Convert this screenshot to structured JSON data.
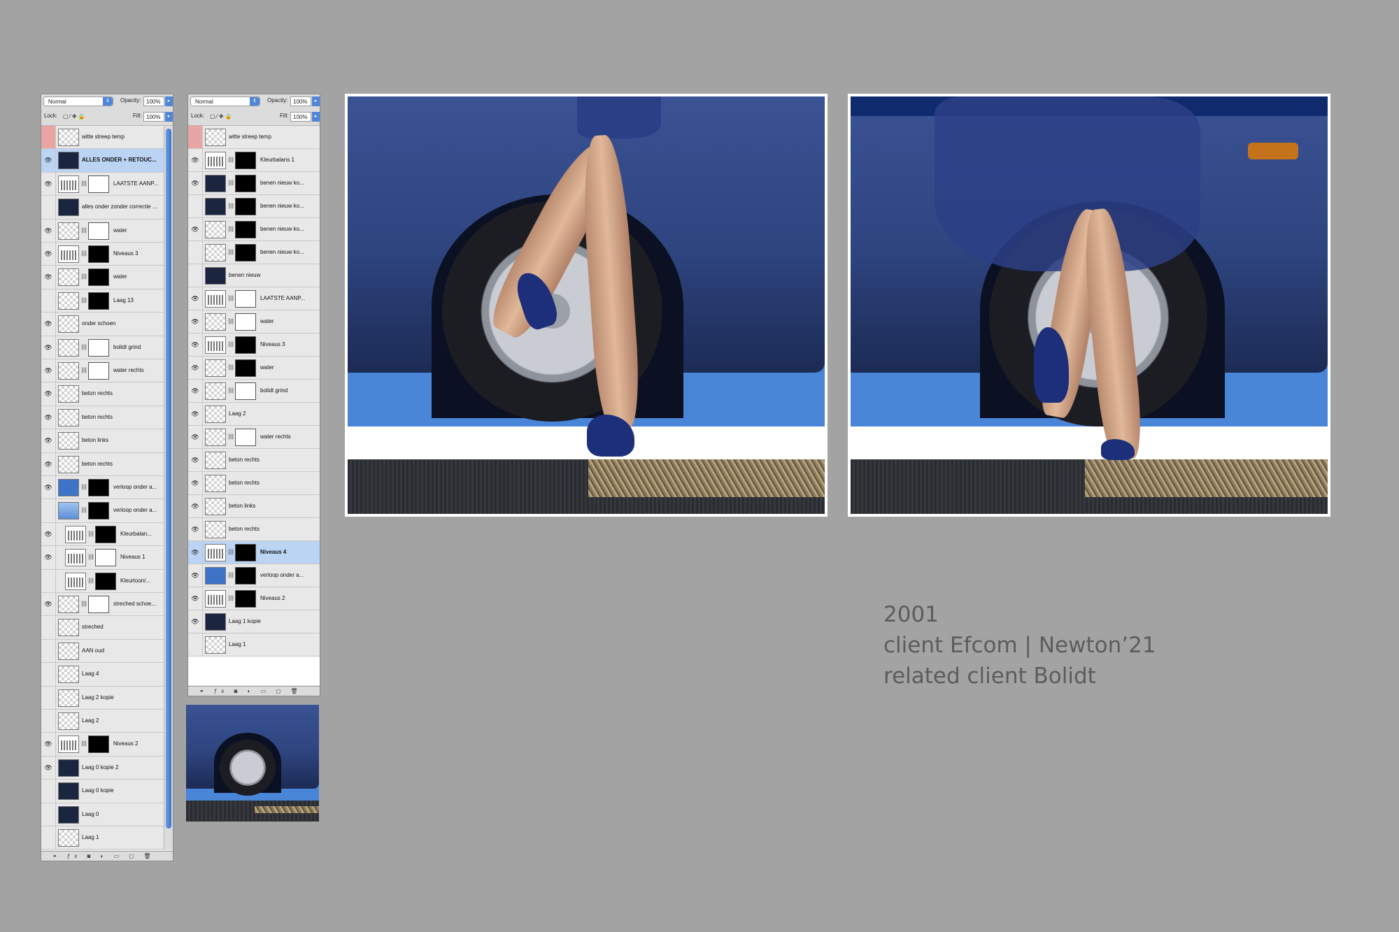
{
  "panel_left": {
    "blend_mode": "Normal",
    "opacity_label": "Opacity:",
    "opacity_value": "100%",
    "lock_label": "Lock:",
    "fill_label": "Fill:",
    "fill_value": "100%",
    "layers": [
      {
        "name": "witte streep temp",
        "visible": false,
        "eye_pink": true,
        "thumb": "checker",
        "mask": null
      },
      {
        "name": "ALLES ONDER + RETOUC...",
        "visible": true,
        "selected": true,
        "thumb": "dark",
        "mask": null
      },
      {
        "name": "LAATSTE AANP...",
        "visible": true,
        "thumb": "adj",
        "mask": "white"
      },
      {
        "name": "alles onder zonder correctie ...",
        "visible": false,
        "thumb": "dark",
        "mask": null
      },
      {
        "name": "water",
        "visible": true,
        "thumb": "checker",
        "mask": "white"
      },
      {
        "name": "Niveaus 3",
        "visible": true,
        "thumb": "adj",
        "mask": "black"
      },
      {
        "name": "water",
        "visible": true,
        "thumb": "checker",
        "mask": "black"
      },
      {
        "name": "Laag 13",
        "visible": false,
        "thumb": "checker",
        "mask": "black"
      },
      {
        "name": "onder schoen",
        "visible": true,
        "thumb": "checker",
        "mask": null
      },
      {
        "name": "bolidt grind",
        "visible": true,
        "thumb": "checker",
        "mask": "white"
      },
      {
        "name": "water rechts",
        "visible": true,
        "thumb": "checker",
        "mask": "white"
      },
      {
        "name": "beton rechts",
        "visible": true,
        "thumb": "checker",
        "mask": null
      },
      {
        "name": "beton rechts",
        "visible": true,
        "thumb": "checker",
        "mask": null
      },
      {
        "name": "beton links",
        "visible": true,
        "thumb": "checker",
        "mask": null
      },
      {
        "name": "beton rechts",
        "visible": true,
        "thumb": "checker",
        "mask": null
      },
      {
        "name": "verloop onder a...",
        "visible": true,
        "thumb": "blue",
        "mask": "black"
      },
      {
        "name": "verloop onder a...",
        "visible": false,
        "thumb": "lblue",
        "mask": "black"
      },
      {
        "name": "Kleurbalan...",
        "visible": true,
        "indent": true,
        "thumb": "adj",
        "mask": "black"
      },
      {
        "name": "Niveaus 1",
        "visible": true,
        "indent": true,
        "thumb": "adj",
        "mask": "white"
      },
      {
        "name": "Kleurtoon/...",
        "visible": false,
        "indent": true,
        "thumb": "adj",
        "mask": "black"
      },
      {
        "name": "streched schoe...",
        "visible": true,
        "thumb": "checker",
        "mask": "white"
      },
      {
        "name": "streched",
        "visible": false,
        "thumb": "checker",
        "mask": null
      },
      {
        "name": "AAN oud",
        "visible": false,
        "thumb": "checker",
        "mask": null
      },
      {
        "name": "Laag 4",
        "visible": false,
        "thumb": "checker",
        "mask": null
      },
      {
        "name": "Laag 2 kopie",
        "visible": false,
        "thumb": "checker",
        "mask": null
      },
      {
        "name": "Laag 2",
        "visible": false,
        "thumb": "checker",
        "mask": null
      },
      {
        "name": "Niveaus 2",
        "visible": true,
        "thumb": "adj",
        "mask": "black"
      },
      {
        "name": "Laag 0 kopie 2",
        "visible": true,
        "thumb": "dark",
        "mask": null
      },
      {
        "name": "Laag 0 kopie",
        "visible": false,
        "thumb": "dark",
        "mask": null
      },
      {
        "name": "Laag 0",
        "visible": false,
        "thumb": "dark",
        "mask": null
      },
      {
        "name": "Laag 1",
        "visible": false,
        "thumb": "checker",
        "mask": null
      }
    ],
    "footer_icons": "⚭ ƒx ◙ ◐ ▭ ◻ 🗑"
  },
  "panel_right": {
    "blend_mode": "Normal",
    "opacity_label": "Opacity:",
    "opacity_value": "100%",
    "lock_label": "Lock:",
    "fill_label": "Fill:",
    "fill_value": "100%",
    "layers": [
      {
        "name": "witte streep temp",
        "visible": false,
        "eye_pink": true,
        "thumb": "checker",
        "mask": null
      },
      {
        "name": "Kleurbalans 1",
        "visible": true,
        "thumb": "adj",
        "mask": "black"
      },
      {
        "name": "benen nieuw ko...",
        "visible": true,
        "thumb": "dark",
        "mask": "black"
      },
      {
        "name": "benen nieuw ko...",
        "visible": false,
        "thumb": "dark",
        "mask": "black"
      },
      {
        "name": "benen nieuw ko...",
        "visible": true,
        "thumb": "checker",
        "mask": "black"
      },
      {
        "name": "benen nieuw ko...",
        "visible": false,
        "thumb": "checker",
        "mask": "black"
      },
      {
        "name": "benen nieuw",
        "visible": false,
        "thumb": "dark",
        "mask": null
      },
      {
        "name": "LAATSTE AANP...",
        "visible": true,
        "thumb": "adj",
        "mask": "white"
      },
      {
        "name": "water",
        "visible": true,
        "thumb": "checker",
        "mask": "white"
      },
      {
        "name": "Niveaus 3",
        "visible": true,
        "thumb": "adj",
        "mask": "black"
      },
      {
        "name": "water",
        "visible": true,
        "thumb": "checker",
        "mask": "black"
      },
      {
        "name": "bolidt grind",
        "visible": true,
        "thumb": "checker",
        "mask": "white"
      },
      {
        "name": "Laag 2",
        "visible": true,
        "thumb": "checker",
        "mask": null
      },
      {
        "name": "water rechts",
        "visible": true,
        "thumb": "checker",
        "mask": "white"
      },
      {
        "name": "beton rechts",
        "visible": true,
        "thumb": "checker",
        "mask": null
      },
      {
        "name": "beton rechts",
        "visible": true,
        "thumb": "checker",
        "mask": null
      },
      {
        "name": "beton links",
        "visible": true,
        "thumb": "checker",
        "mask": null
      },
      {
        "name": "beton rechts",
        "visible": true,
        "thumb": "checker",
        "mask": null
      },
      {
        "name": "Niveaus 4",
        "visible": true,
        "selected": true,
        "thumb": "adj",
        "mask": "black"
      },
      {
        "name": "verloop onder a...",
        "visible": true,
        "thumb": "blue",
        "mask": "black"
      },
      {
        "name": "Niveaus 2",
        "visible": true,
        "thumb": "adj",
        "mask": "black"
      },
      {
        "name": "Laag 1 kopie",
        "visible": true,
        "thumb": "dark",
        "mask": null
      },
      {
        "name": "Laag 1",
        "visible": false,
        "thumb": "checker",
        "mask": null
      }
    ],
    "footer_icons": "⚭ ƒx ◙ ◐ ▭ ◻ 🗑"
  },
  "caption": {
    "year": "2001",
    "client": "client Efcom | Newton’21",
    "related": "related client  Bolidt"
  },
  "colors": {
    "background": "#a3a3a3",
    "sky_blue": "#4a86d8",
    "car_blue": "#2e4580",
    "selection": "#bcd4f4",
    "caption_text": "#5c5c5c"
  }
}
